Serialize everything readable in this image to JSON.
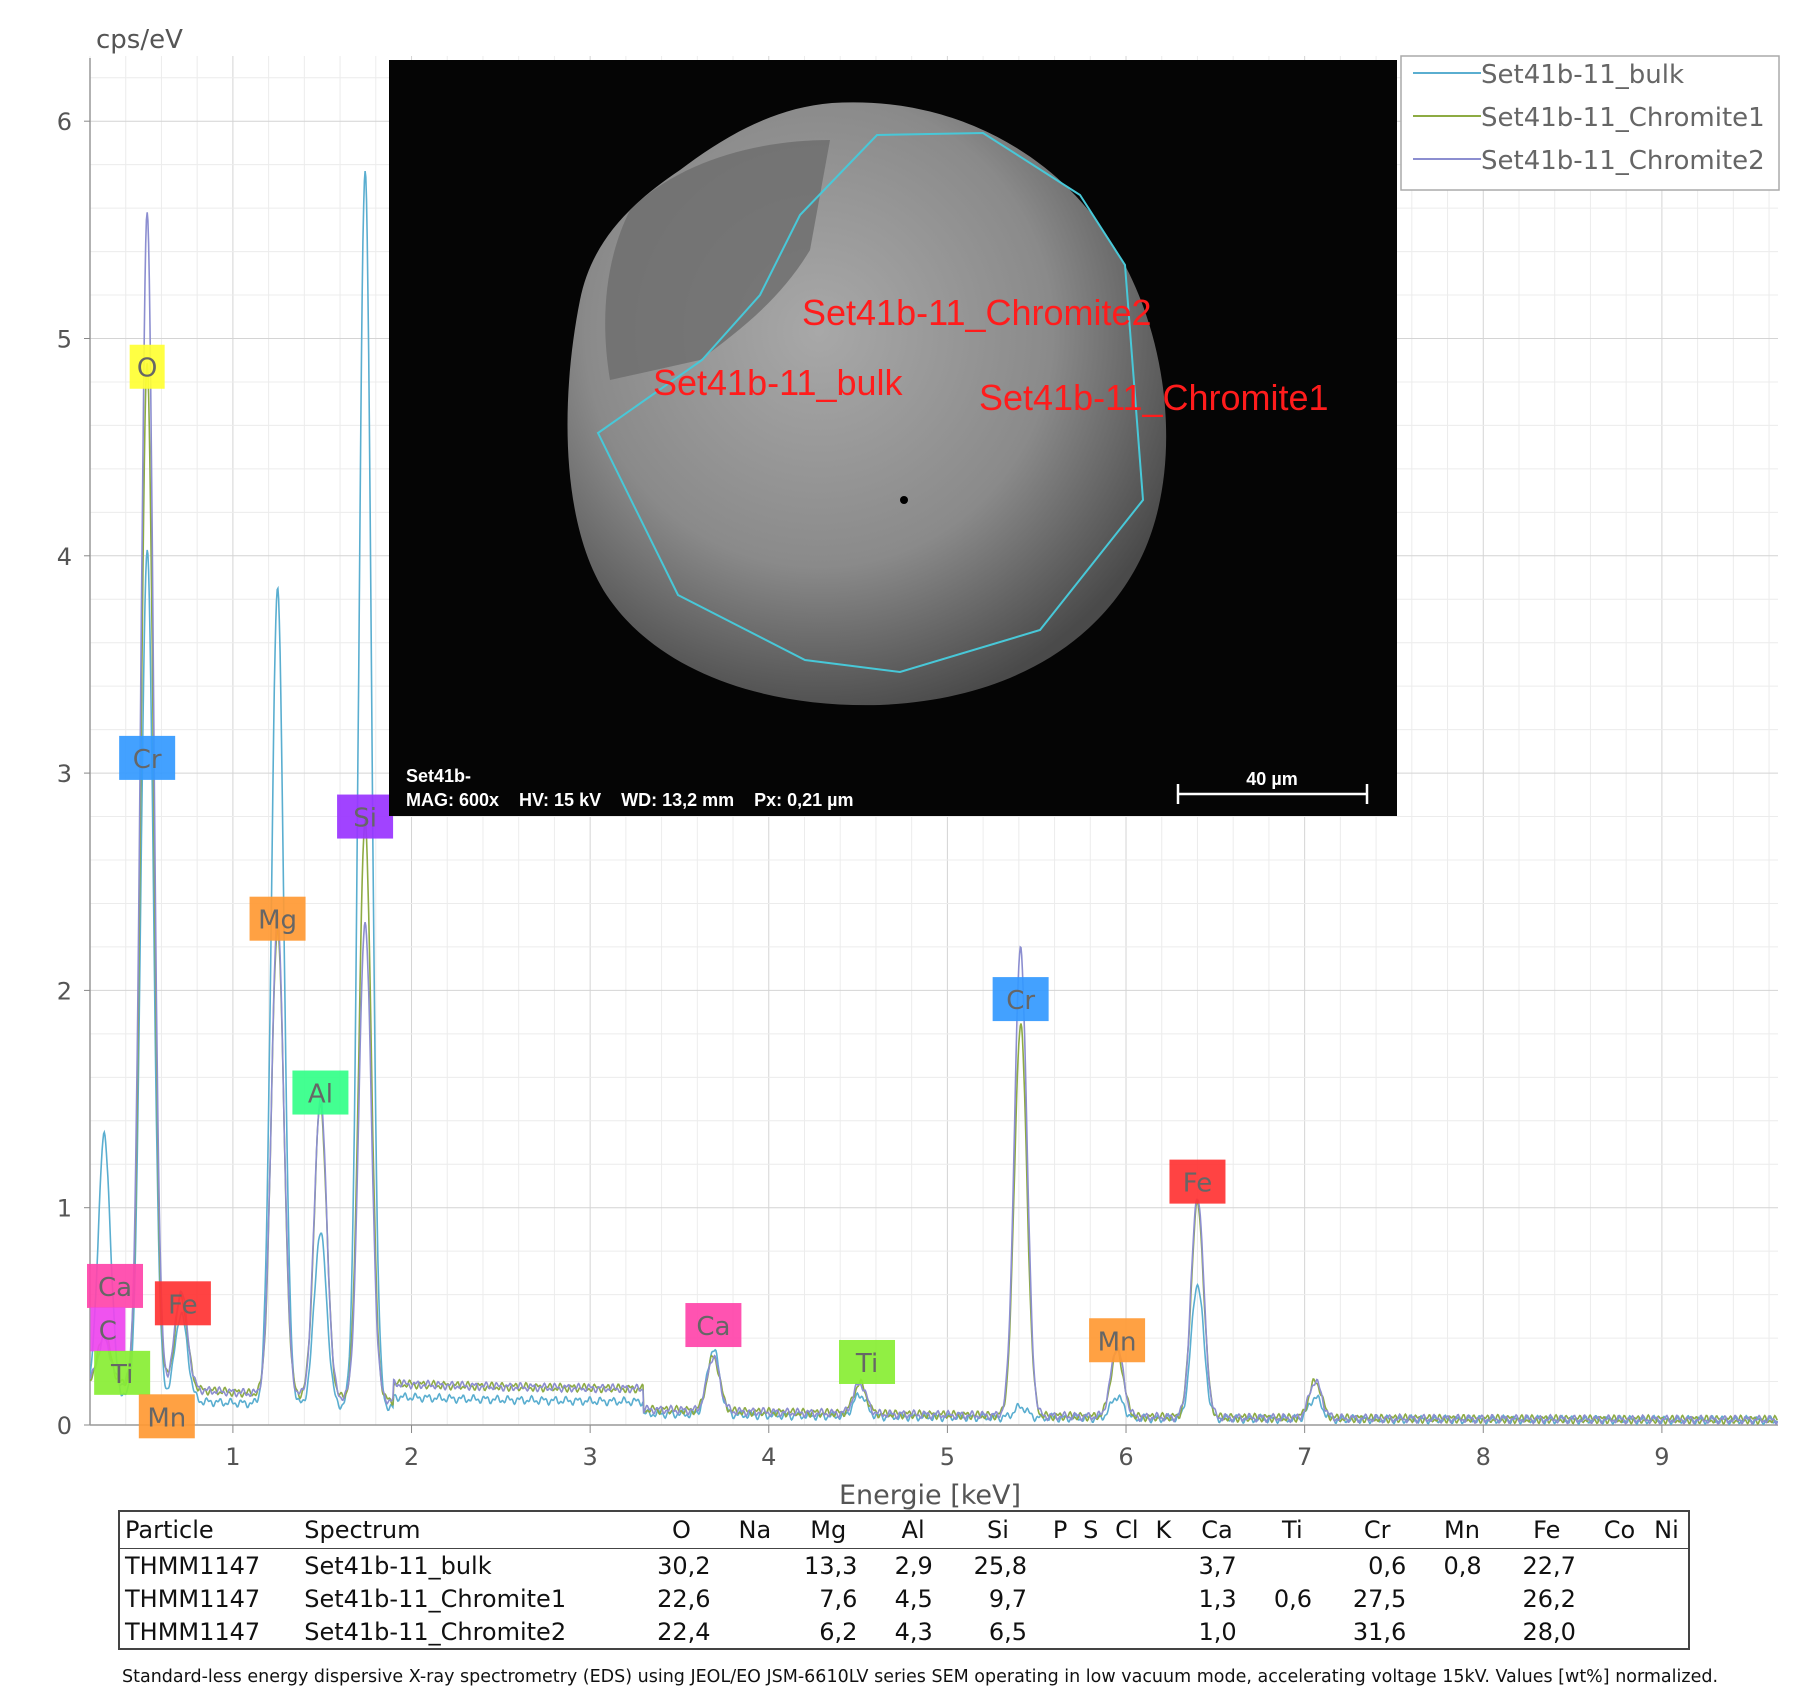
{
  "chart_data": {
    "type": "line",
    "ylabel": "cps/eV",
    "xlabel": "Energie [keV]",
    "xlim": [
      0.2,
      9.65
    ],
    "ylim": [
      0,
      6.3
    ],
    "xticks": [
      1,
      2,
      3,
      4,
      5,
      6,
      7,
      8,
      9
    ],
    "yticks": [
      0,
      1,
      2,
      3,
      4,
      5,
      6
    ],
    "grid": true,
    "legend_position": "top-right",
    "background": 0.08,
    "peak_width": 0.035,
    "series": [
      {
        "name": "Set41b-11_bulk",
        "color": "#5aaed0",
        "baseline_level": 0.1,
        "peaks": [
          [
            0.28,
            1.2
          ],
          [
            0.52,
            3.9
          ],
          [
            0.71,
            0.4
          ],
          [
            1.25,
            3.75
          ],
          [
            1.49,
            0.8
          ],
          [
            1.74,
            5.7
          ],
          [
            3.69,
            0.3
          ],
          [
            4.51,
            0.1
          ],
          [
            5.41,
            0.05
          ],
          [
            5.95,
            0.1
          ],
          [
            6.4,
            0.62
          ],
          [
            7.06,
            0.1
          ]
        ]
      },
      {
        "name": "Set41b-11_Chromite1",
        "color": "#8dab43",
        "baseline_level": 0.16,
        "peaks": [
          [
            0.28,
            0.22
          ],
          [
            0.52,
            4.7
          ],
          [
            0.71,
            0.42
          ],
          [
            1.25,
            2.15
          ],
          [
            1.49,
            1.35
          ],
          [
            1.74,
            2.65
          ],
          [
            3.69,
            0.25
          ],
          [
            4.51,
            0.14
          ],
          [
            5.41,
            1.8
          ],
          [
            5.95,
            0.3
          ],
          [
            6.4,
            0.98
          ],
          [
            7.06,
            0.17
          ]
        ]
      },
      {
        "name": "Set41b-11_Chromite2",
        "color": "#8c8ed0",
        "baseline_level": 0.16,
        "peaks": [
          [
            0.28,
            0.2
          ],
          [
            0.52,
            5.4
          ],
          [
            0.71,
            0.45
          ],
          [
            1.25,
            2.2
          ],
          [
            1.49,
            1.38
          ],
          [
            1.74,
            2.2
          ],
          [
            3.69,
            0.25
          ],
          [
            4.51,
            0.14
          ],
          [
            5.41,
            2.15
          ],
          [
            5.95,
            0.32
          ],
          [
            6.4,
            1.02
          ],
          [
            7.06,
            0.17
          ]
        ]
      }
    ],
    "peak_labels": [
      {
        "text": "O",
        "x": 0.52,
        "y": 4.87,
        "color": "#ffff33"
      },
      {
        "text": "Cr",
        "x": 0.52,
        "y": 3.07,
        "color": "#3399ff"
      },
      {
        "text": "Si",
        "x": 1.74,
        "y": 2.8,
        "color": "#9933ff"
      },
      {
        "text": "Mg",
        "x": 1.25,
        "y": 2.33,
        "color": "#ff9933"
      },
      {
        "text": "Al",
        "x": 1.49,
        "y": 1.53,
        "color": "#33ff88"
      },
      {
        "text": "Cr",
        "x": 5.41,
        "y": 1.96,
        "color": "#3399ff"
      },
      {
        "text": "Fe",
        "x": 6.4,
        "y": 1.12,
        "color": "#ff3333"
      },
      {
        "text": "Ca",
        "x": 0.34,
        "y": 0.64,
        "color": "#ff44aa"
      },
      {
        "text": "Fe",
        "x": 0.72,
        "y": 0.56,
        "color": "#ff3333"
      },
      {
        "text": "C",
        "x": 0.3,
        "y": 0.44,
        "color": "#ee44ee"
      },
      {
        "text": "Ti",
        "x": 0.38,
        "y": 0.24,
        "color": "#88ee33"
      },
      {
        "text": "Mn",
        "x": 0.63,
        "y": 0.04,
        "color": "#ff9933"
      },
      {
        "text": "Ca",
        "x": 3.69,
        "y": 0.46,
        "color": "#ff44aa"
      },
      {
        "text": "Ti",
        "x": 4.55,
        "y": 0.29,
        "color": "#88ee33"
      },
      {
        "text": "Mn",
        "x": 5.95,
        "y": 0.39,
        "color": "#ff9933"
      }
    ]
  },
  "sem_image": {
    "spot_labels": [
      {
        "text": "Set41b-11_Chromite2"
      },
      {
        "text": "Set41b-11_bulk"
      },
      {
        "text": "Set41b-11_Chromite1"
      }
    ],
    "info_line1": "Set41b-",
    "info_line2": "MAG: 600x    HV: 15 kV    WD: 13,2 mm    Px: 0,21 µm",
    "scale_label": "40 µm"
  },
  "table": {
    "headers": [
      "Particle",
      "Spectrum",
      "O",
      "Na",
      "Mg",
      "Al",
      "Si",
      "P",
      "S",
      "Cl",
      "K",
      "Ca",
      "Ti",
      "Cr",
      "Mn",
      "Fe",
      "Co",
      "Ni"
    ],
    "rows": [
      [
        "THMM1147",
        "Set41b-11_bulk",
        "30,2",
        "",
        "13,3",
        "2,9",
        "25,8",
        "",
        "",
        "",
        "",
        "3,7",
        "",
        "0,6",
        "0,8",
        "22,7",
        "",
        ""
      ],
      [
        "THMM1147",
        "Set41b-11_Chromite1",
        "22,6",
        "",
        "7,6",
        "4,5",
        "9,7",
        "",
        "",
        "",
        "",
        "1,3",
        "0,6",
        "27,5",
        "",
        "26,2",
        "",
        ""
      ],
      [
        "THMM1147",
        "Set41b-11_Chromite2",
        "22,4",
        "",
        "6,2",
        "4,3",
        "6,5",
        "",
        "",
        "",
        "",
        "1,0",
        "",
        "31,6",
        "",
        "28,0",
        "",
        ""
      ]
    ]
  },
  "caption": "Standard-less energy dispersive X-ray spectrometry (EDS) using JEOL/EO JSM-6610LV series SEM operating in low vacuum mode, accelerating voltage 15kV. Values [wt%] normalized."
}
